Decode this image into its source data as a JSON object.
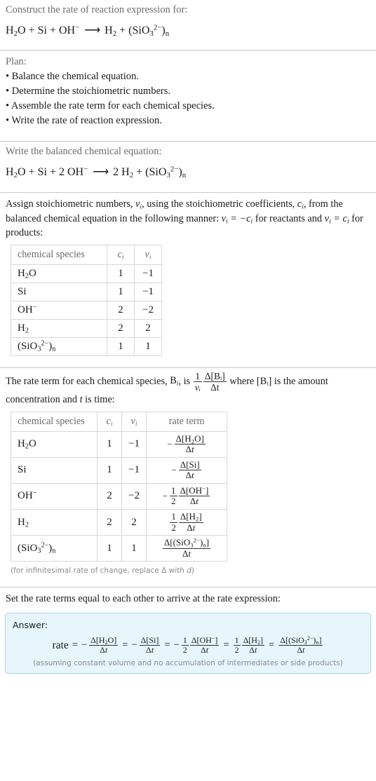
{
  "header": {
    "prompt": "Construct the rate of reaction expression for:",
    "equation_unbalanced": "H2O + Si + OH^- ⟶ H2 + (SiO3^2-)n"
  },
  "plan": {
    "title": "Plan:",
    "items": [
      "Balance the chemical equation.",
      "Determine the stoichiometric numbers.",
      "Assemble the rate term for each chemical species.",
      "Write the rate of reaction expression."
    ],
    "bullet": "•"
  },
  "balanced": {
    "label": "Write the balanced chemical equation:",
    "equation": "H2O + Si + 2 OH^- ⟶ 2 H2 + (SiO3^2-)n",
    "coefficients": {
      "H2O": "",
      "Si": "",
      "OH": "2",
      "H2": "2",
      "SiO3": ""
    }
  },
  "stoich": {
    "paragraph_1": "Assign stoichiometric numbers, ",
    "paragraph_2": ", using the stoichiometric coefficients, ",
    "paragraph_3": ", from the balanced chemical equation in the following manner: ",
    "paragraph_4": " for reactants and ",
    "paragraph_5": " for products:",
    "nu_i": "ν",
    "c_i": "c",
    "sub_i": "i",
    "rel_reactants": "νᵢ = −cᵢ",
    "rel_products": "νᵢ = cᵢ"
  },
  "table1": {
    "headers": {
      "species": "chemical species",
      "c": "c",
      "nu": "ν",
      "sub": "i"
    },
    "rows": [
      {
        "species": "H2O",
        "c": "1",
        "nu": "−1"
      },
      {
        "species": "Si",
        "c": "1",
        "nu": "−1"
      },
      {
        "species": "OH-",
        "c": "2",
        "nu": "−2"
      },
      {
        "species": "H2",
        "c": "2",
        "nu": "2"
      },
      {
        "species": "(SiO3^2-)n",
        "c": "1",
        "nu": "1"
      }
    ]
  },
  "rateterm": {
    "text_1": "The rate term for each chemical species, ",
    "text_B": "B",
    "text_2": ", is ",
    "text_3": " where [Bᵢ] is the amount concentration and ",
    "text_t": "t",
    "text_4": " is time:",
    "frac_num": "1",
    "frac_den": "νᵢ",
    "frac2_num": "Δ[Bᵢ]",
    "frac2_den": "Δt"
  },
  "table2": {
    "headers": {
      "species": "chemical species",
      "c": "c",
      "nu": "ν",
      "sub": "i",
      "rate": "rate term"
    },
    "rows": [
      {
        "species": "H2O",
        "c": "1",
        "nu": "−1",
        "sign": "−",
        "coef": "",
        "num": "Δ[H2O]",
        "den": "Δt"
      },
      {
        "species": "Si",
        "c": "1",
        "nu": "−1",
        "sign": "−",
        "coef": "",
        "num": "Δ[Si]",
        "den": "Δt"
      },
      {
        "species": "OH-",
        "c": "2",
        "nu": "−2",
        "sign": "−",
        "coef": "1/2",
        "num": "Δ[OH⁻]",
        "den": "Δt"
      },
      {
        "species": "H2",
        "c": "2",
        "nu": "2",
        "sign": "",
        "coef": "1/2",
        "num": "Δ[H2]",
        "den": "Δt"
      },
      {
        "species": "(SiO3^2-)n",
        "c": "1",
        "nu": "1",
        "sign": "",
        "coef": "",
        "num": "Δ[(SiO3^2−)n]",
        "den": "Δt"
      }
    ],
    "footnote": "(for infinitesimal rate of change, replace Δ with d)",
    "footnote_a": "(for infinitesimal rate of change, replace Δ with ",
    "footnote_d": "d",
    "footnote_b": ")"
  },
  "final": {
    "label": "Set the rate terms equal to each other to arrive at the rate expression:"
  },
  "answer": {
    "label": "Answer:",
    "rate_word": "rate",
    "equals": "=",
    "note": "(assuming constant volume and no accumulation of intermediates or side products)",
    "terms": [
      {
        "sign": "−",
        "coef": "",
        "num": "Δ[H2O]",
        "den": "Δt"
      },
      {
        "sign": "−",
        "coef": "",
        "num": "Δ[Si]",
        "den": "Δt"
      },
      {
        "sign": "−",
        "coef": "1/2",
        "num": "Δ[OH⁻]",
        "den": "Δt"
      },
      {
        "sign": "",
        "coef": "1/2",
        "num": "Δ[H2]",
        "den": "Δt"
      },
      {
        "sign": "",
        "coef": "",
        "num": "Δ[(SiO3^2−)n]",
        "den": "Δt"
      }
    ]
  },
  "colors": {
    "answer_bg": "#e6f6fb",
    "answer_border": "#a8d8e8",
    "divider": "#c9c9c9",
    "table_border": "#d8d8d8",
    "muted_text": "#6b6b6b",
    "body_text": "#1a1a1a"
  }
}
